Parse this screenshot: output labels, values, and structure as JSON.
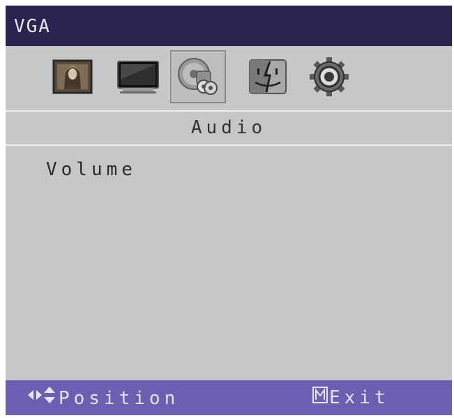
{
  "window": {
    "title": "VGA"
  },
  "tabs": [
    {
      "icon": "mona-lisa-picture-icon"
    },
    {
      "icon": "monitor-display-icon"
    },
    {
      "icon": "audio-speaker-disc-icon",
      "selected": true
    },
    {
      "icon": "macos-finder-face-icon"
    },
    {
      "icon": "settings-gear-icon"
    }
  ],
  "section": {
    "title": "Audio"
  },
  "menu": {
    "items": [
      {
        "label": "Volume"
      }
    ]
  },
  "footer": {
    "nav_hint": "Position",
    "nav_icon": "arrows-icon",
    "exit_hint": "Exit",
    "exit_icon": "m-key-icon"
  },
  "colors": {
    "titlebar": "#2a2550",
    "panel": "#c6c6c6",
    "footer": "#6a5fb0",
    "text": "#2b2b2b"
  }
}
